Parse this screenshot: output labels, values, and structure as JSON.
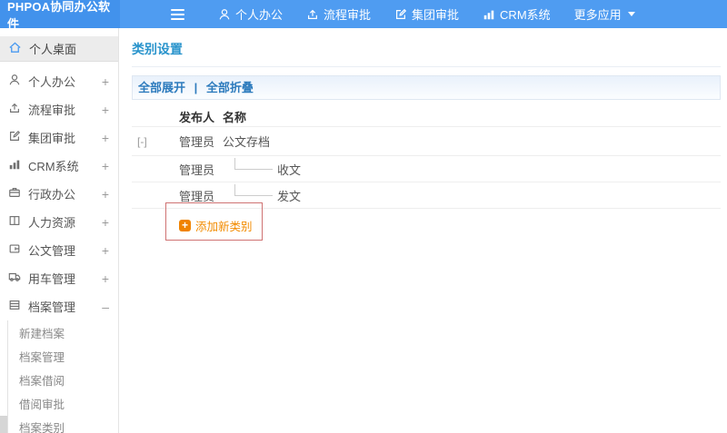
{
  "header": {
    "logo": "PHPOA协同办公软件",
    "nav": [
      {
        "label": "个人办公",
        "icon": "user-icon"
      },
      {
        "label": "流程审批",
        "icon": "workflow-icon"
      },
      {
        "label": "集团审批",
        "icon": "edit-icon"
      },
      {
        "label": "CRM系统",
        "icon": "chart-icon"
      },
      {
        "label": "更多应用",
        "icon": "caret-down-icon"
      }
    ]
  },
  "sidebar": {
    "items": [
      {
        "label": "个人桌面",
        "icon": "home-icon",
        "expander": ""
      },
      {
        "label": "个人办公",
        "icon": "user-icon",
        "expander": "+"
      },
      {
        "label": "流程审批",
        "icon": "workflow-icon",
        "expander": "+"
      },
      {
        "label": "集团审批",
        "icon": "edit-icon",
        "expander": "+"
      },
      {
        "label": "CRM系统",
        "icon": "chart-icon",
        "expander": "+"
      },
      {
        "label": "行政办公",
        "icon": "briefcase-icon",
        "expander": "+"
      },
      {
        "label": "人力资源",
        "icon": "book-icon",
        "expander": "+"
      },
      {
        "label": "公文管理",
        "icon": "document-icon",
        "expander": "+"
      },
      {
        "label": "用车管理",
        "icon": "truck-icon",
        "expander": "+"
      },
      {
        "label": "档案管理",
        "icon": "archive-icon",
        "expander": "–"
      }
    ],
    "submenu": [
      "新建档案",
      "档案管理",
      "档案借阅",
      "借阅审批",
      "档案类别"
    ]
  },
  "main": {
    "title": "类别设置",
    "toolbar": {
      "expand_all": "全部展开",
      "separator": "|",
      "collapse_all": "全部折叠"
    },
    "table": {
      "columns": [
        "发布人",
        "名称"
      ],
      "rows": [
        {
          "expander": "[-]",
          "publisher": "管理员",
          "name": "公文存档",
          "child": false
        },
        {
          "expander": "",
          "publisher": "管理员",
          "name": "收文",
          "child": true
        },
        {
          "expander": "",
          "publisher": "管理员",
          "name": "发文",
          "child": true
        }
      ],
      "add_label": "添加新类别",
      "add_icon_glyph": "+"
    }
  },
  "colors": {
    "header_blue": "#4f9cf1",
    "logo_blue": "#4292ec",
    "title_blue": "#2a94cc",
    "link_blue": "#2d7bbd",
    "add_orange": "#f28b00",
    "highlight_red": "#cf7272",
    "active_item_gray": "#ececec"
  }
}
